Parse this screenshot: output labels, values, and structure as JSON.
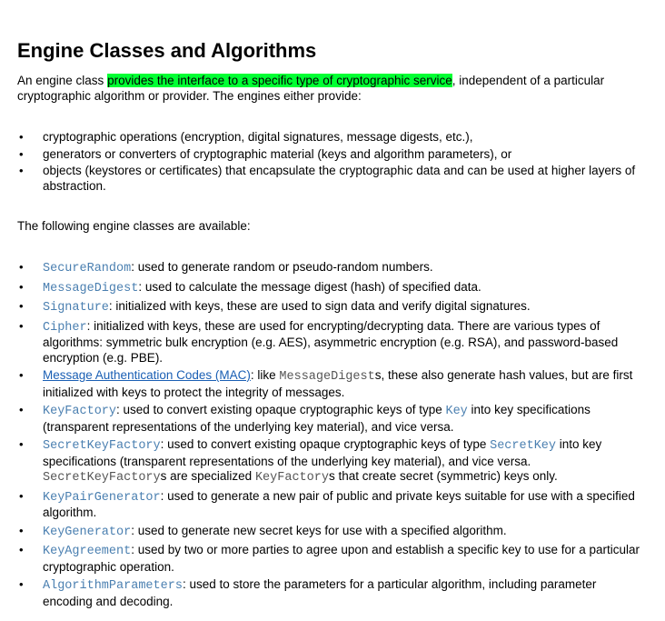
{
  "title": "Engine Classes and Algorithms",
  "intro": {
    "before": "An engine class ",
    "highlight": "provides the interface to a specific type of cryptographic service",
    "after": ", independent of a particular cryptographic algorithm or provider. The engines either provide:"
  },
  "provides": [
    "cryptographic operations (encryption, digital signatures, message digests, etc.),",
    "generators or converters of cryptographic material (keys and algorithm parameters), or",
    "objects (keystores or certificates) that encapsulate the cryptographic data and can be used at higher layers of abstraction."
  ],
  "available_intro": "The following engine classes are available:",
  "engines": {
    "secure_random": {
      "code": "SecureRandom",
      "text": ": used to generate random or pseudo-random numbers."
    },
    "message_digest": {
      "code": "MessageDigest",
      "text": ": used to calculate the message digest (hash) of specified data."
    },
    "signature": {
      "code": "Signature",
      "text": ": initialized with keys, these are used to sign data and verify digital signatures."
    },
    "cipher": {
      "code": "Cipher",
      "text": ": initialized with keys, these are used for encrypting/decrypting data. There are various types of algorithms: symmetric bulk encryption (e.g. AES), asymmetric encryption (e.g. RSA), and password-based encryption (e.g. PBE)."
    },
    "mac": {
      "link": "Message Authentication Codes (MAC)",
      "t1": ": like ",
      "code": "MessageDigest",
      "t2": "s, these also generate hash values, but are first initialized with keys to protect the integrity of messages."
    },
    "key_factory": {
      "code": "KeyFactory",
      "t1": ": used to convert existing opaque cryptographic keys of type ",
      "code2": "Key",
      "t2": " into key specifications (transparent representations of the underlying key material), and vice versa."
    },
    "secret_key_factory": {
      "code": "SecretKeyFactory",
      "t1": ": used to convert existing opaque cryptographic keys of type ",
      "code2": "SecretKey",
      "t2": " into key specifications (transparent representations of the underlying key material), and vice versa. ",
      "code3": "SecretKeyFactory",
      "t3": "s are specialized ",
      "code4": "KeyFactory",
      "t4": "s that create secret (symmetric) keys only."
    },
    "key_pair_generator": {
      "code": "KeyPairGenerator",
      "text": ": used to generate a new pair of public and private keys suitable for use with a specified algorithm."
    },
    "key_generator": {
      "code": "KeyGenerator",
      "text": ": used to generate new secret keys for use with a specified algorithm."
    },
    "key_agreement": {
      "code": "KeyAgreement",
      "text": ": used by two or more parties to agree upon and establish a specific key to use for a particular cryptographic operation."
    },
    "algorithm_parameters": {
      "code": "AlgorithmParameters",
      "text": ": used to store the parameters for a particular algorithm, including parameter encoding and decoding."
    }
  },
  "colors": {
    "highlight": "#00ff33",
    "code": "#4a7fb0",
    "link": "#1a5fb4"
  },
  "bullet_glyph": "•"
}
